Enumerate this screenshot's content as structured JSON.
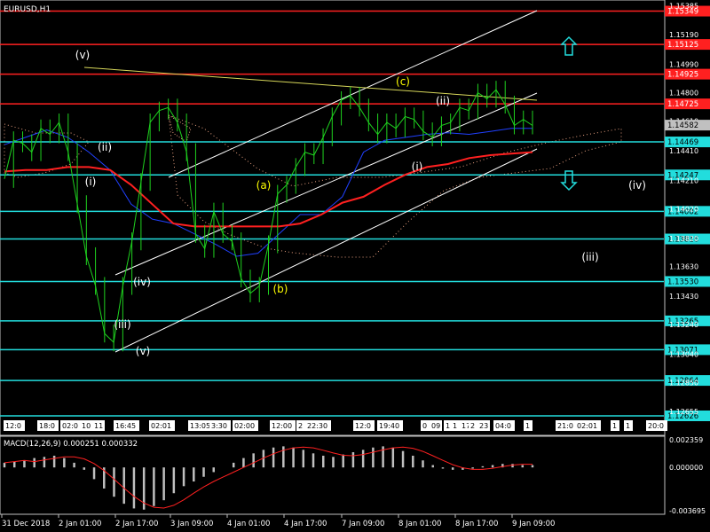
{
  "chart_data": {
    "type": "line",
    "symbol": "EURUSD,H1",
    "macd_label": "MACD(12,26,9) 0.000251 0.000332",
    "current_price": "1.14582",
    "y_ticks": [
      "1.15385",
      "1.15190",
      "1.14990",
      "1.14800",
      "1.14610",
      "1.14410",
      "1.14210",
      "1.14020",
      "1.13820",
      "1.13630",
      "1.13430",
      "1.13240",
      "1.13040",
      "1.12850",
      "1.12655"
    ],
    "macd_ticks": [
      "0.002359",
      "0.000000",
      "-0.003695"
    ],
    "x_ticks": [
      "31 Dec 2018",
      "2 Jan 01:00",
      "2 Jan 17:00",
      "3 Jan 09:00",
      "4 Jan 01:00",
      "4 Jan 17:00",
      "7 Jan 09:00",
      "8 Jan 01:00",
      "8 Jan 17:00",
      "9 Jan 09:00"
    ],
    "price_range": [
      1.1262,
      1.154
    ],
    "levels": [
      {
        "price": "1.15349",
        "color": "#ff2020"
      },
      {
        "price": "1.15125",
        "color": "#ff2020"
      },
      {
        "price": "1.14925",
        "color": "#ff2020"
      },
      {
        "price": "1.14725",
        "color": "#ff2020"
      },
      {
        "price": "1.14469",
        "color": "#22dddd"
      },
      {
        "price": "1.14247",
        "color": "#22dddd"
      },
      {
        "price": "1.14002",
        "color": "#22dddd"
      },
      {
        "price": "1.13816",
        "color": "#22dddd"
      },
      {
        "price": "1.13530",
        "color": "#22dddd"
      },
      {
        "price": "1.13265",
        "color": "#22dddd"
      },
      {
        "price": "1.13071",
        "color": "#22dddd"
      },
      {
        "price": "1.12864",
        "color": "#22dddd"
      },
      {
        "price": "1.12626",
        "color": "#22dddd"
      }
    ],
    "wave_labels": [
      {
        "text": "(v)",
        "color": "#ffffff"
      },
      {
        "text": "(ii)",
        "color": "#ffffff"
      },
      {
        "text": "(i)",
        "color": "#ffffff"
      },
      {
        "text": "(iv)",
        "color": "#ffffff"
      },
      {
        "text": "(iii)",
        "color": "#ffffff"
      },
      {
        "text": "(v)",
        "color": "#ffffff"
      },
      {
        "text": "(a)",
        "color": "#ffff00"
      },
      {
        "text": "(b)",
        "color": "#ffff00"
      },
      {
        "text": "(c)",
        "color": "#ffff00"
      },
      {
        "text": "(ii)",
        "color": "#ffffff"
      },
      {
        "text": "(i)",
        "color": "#ffffff"
      },
      {
        "text": "(iv)",
        "color": "#ffffff"
      },
      {
        "text": "(iii)",
        "color": "#ffffff"
      }
    ],
    "time_labels": [
      "12:0",
      "18:0",
      "02:0",
      "10",
      "11",
      "16:45",
      "02:01",
      "13:05",
      "3:30",
      "02:00",
      "12:00",
      "2",
      "22:30",
      "12:0",
      "19:40",
      "0",
      "09",
      "1",
      "1",
      "17",
      "2",
      "23",
      "04:0",
      "1",
      "21:0",
      "02:01",
      "1",
      "1",
      "20:0"
    ],
    "series": [
      {
        "name": "close",
        "color": "#1fd21f",
        "values": [
          1.1422,
          1.1448,
          1.1446,
          1.144,
          1.1456,
          1.1452,
          1.146,
          1.144,
          1.1405,
          1.137,
          1.135,
          1.1318,
          1.1312,
          1.135,
          1.138,
          1.142,
          1.146,
          1.1468,
          1.147,
          1.146,
          1.144,
          1.1385,
          1.1375,
          1.14,
          1.1385,
          1.138,
          1.1355,
          1.1345,
          1.135,
          1.1378,
          1.1412,
          1.1418,
          1.143,
          1.144,
          1.1438,
          1.145,
          1.1464,
          1.1475,
          1.1478,
          1.147,
          1.146,
          1.1452,
          1.146,
          1.1456,
          1.1464,
          1.1462,
          1.1454,
          1.145,
          1.1458,
          1.146,
          1.147,
          1.1468,
          1.148,
          1.1476,
          1.1482,
          1.1472,
          1.1458,
          1.1462,
          1.1458
        ]
      },
      {
        "name": "ma_red",
        "color": "#ff2020",
        "values": [
          1.1427,
          1.1428,
          1.1428,
          1.143,
          1.143,
          1.1428,
          1.1418,
          1.1405,
          1.1392,
          1.139,
          1.139,
          1.139,
          1.139,
          1.139,
          1.1392,
          1.1398,
          1.1406,
          1.141,
          1.1418,
          1.1425,
          1.143,
          1.1432,
          1.1436,
          1.1438,
          1.1439,
          1.144
        ]
      },
      {
        "name": "ma_blue",
        "color": "#2040ff",
        "values": [
          1.1445,
          1.145,
          1.1455,
          1.145,
          1.144,
          1.1428,
          1.1405,
          1.1395,
          1.1392,
          1.1385,
          1.1378,
          1.137,
          1.1372,
          1.1385,
          1.1398,
          1.1398,
          1.141,
          1.144,
          1.1448,
          1.145,
          1.1452,
          1.1453,
          1.1452,
          1.1454,
          1.1456,
          1.1456
        ]
      }
    ],
    "macd_hist": [
      0.0004,
      0.0005,
      0.0006,
      0.0008,
      0.0009,
      0.001,
      0.0008,
      0.0004,
      -0.0002,
      -0.001,
      -0.0018,
      -0.0025,
      -0.0031,
      -0.0035,
      -0.0036,
      -0.0033,
      -0.0028,
      -0.0022,
      -0.0016,
      -0.0012,
      -0.0008,
      -0.0004,
      0.0,
      0.0004,
      0.0008,
      0.0012,
      0.0015,
      0.0017,
      0.0018,
      0.0017,
      0.0015,
      0.0012,
      0.001,
      0.0009,
      0.0011,
      0.0013,
      0.0015,
      0.0017,
      0.0018,
      0.0017,
      0.0014,
      0.001,
      0.0006,
      0.0002,
      -0.0001,
      -0.0002,
      -0.0002,
      -0.0001,
      0.0001,
      0.0002,
      0.0003,
      0.0003,
      0.0002,
      0.0002
    ]
  }
}
